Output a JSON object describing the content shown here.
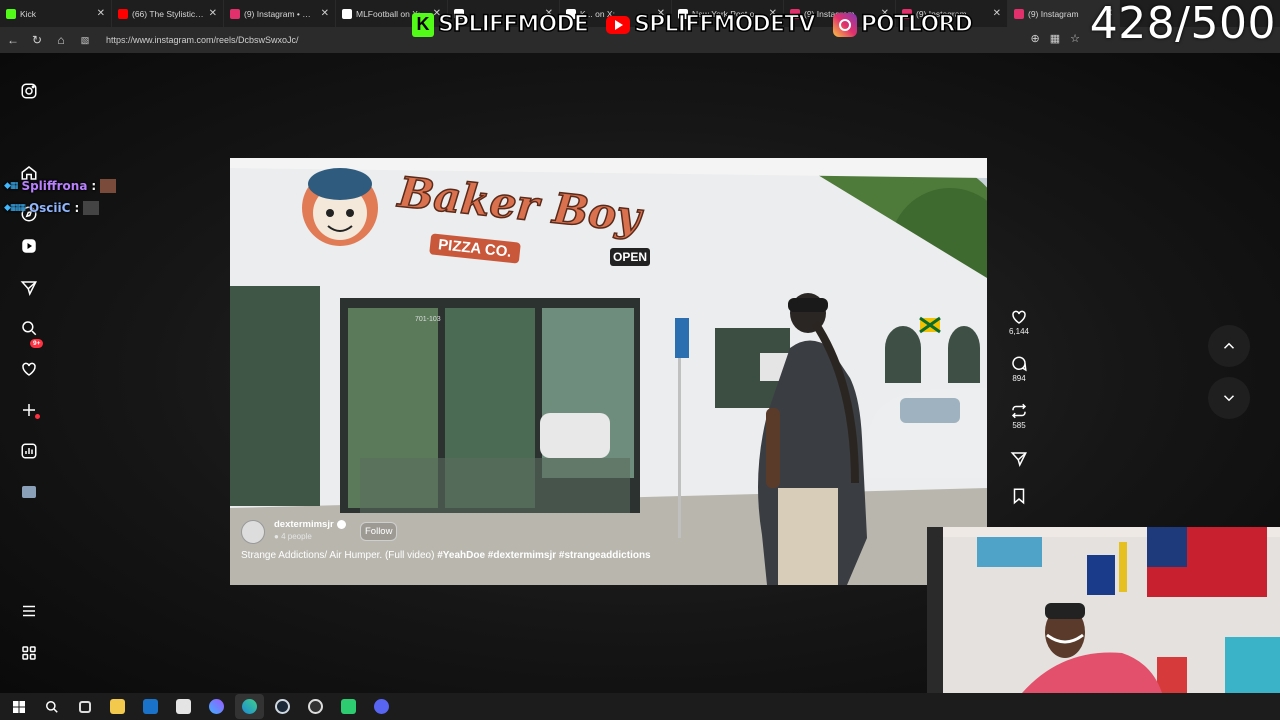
{
  "browser": {
    "tabs": [
      {
        "label": "Kick",
        "icon": "kick-icon",
        "color": "#53fc18",
        "active": false
      },
      {
        "label": "(66) The Stylistics - ...",
        "icon": "youtube-icon",
        "color": "#ff0000",
        "active": false
      },
      {
        "label": "(9) Instagram • Mess...",
        "icon": "instagram-icon",
        "color": "#e1306c",
        "active": false
      },
      {
        "label": "MLFootball on X:",
        "icon": "x-icon",
        "color": "#ffffff",
        "active": false
      },
      {
        "label": "",
        "icon": "x-icon",
        "color": "#ffffff",
        "active": false
      },
      {
        "label": "K... on X: ...",
        "icon": "x-icon",
        "color": "#ffffff",
        "active": false
      },
      {
        "label": "New York Post on X:",
        "icon": "x-icon",
        "color": "#ffffff",
        "active": false
      },
      {
        "label": "(9) Instagram",
        "icon": "instagram-icon",
        "color": "#e1306c",
        "active": false
      },
      {
        "label": "(9) Instagram",
        "icon": "instagram-icon",
        "color": "#e1306c",
        "active": false
      },
      {
        "label": "(9) Instagram",
        "icon": "instagram-icon",
        "color": "#e1306c",
        "active": true
      }
    ],
    "url": "https://www.instagram.com/reels/DcbswSwxoJc/"
  },
  "overlay": {
    "kick_name": "SPLIFFMODE",
    "youtube_name": "SPLIFFMODETV",
    "instagram_name": "POTLORD",
    "counter": "428/500"
  },
  "chat": [
    {
      "name": "Spliffrona",
      "sep": ":",
      "color": "#b980ff"
    },
    {
      "name": "OsciiC",
      "sep": ":",
      "color": "#8fb6ff"
    }
  ],
  "sidebar": {
    "notifications_badge": "9+"
  },
  "post": {
    "username": "dextermimsjr",
    "people": "4 people",
    "follow_label": "Follow",
    "caption_text": "Strange Addictions/ Air Humper. (Full video) ",
    "caption_tags": "#YeahDoe #dextermimsjr #strangeaddictions",
    "likes": "6,144",
    "comments": "894",
    "reposts": "585"
  },
  "video": {
    "sign_line1": "Baker Boy",
    "sign_line2": "PIZZA CO.",
    "open_sign": "OPEN",
    "address": "701-103"
  }
}
